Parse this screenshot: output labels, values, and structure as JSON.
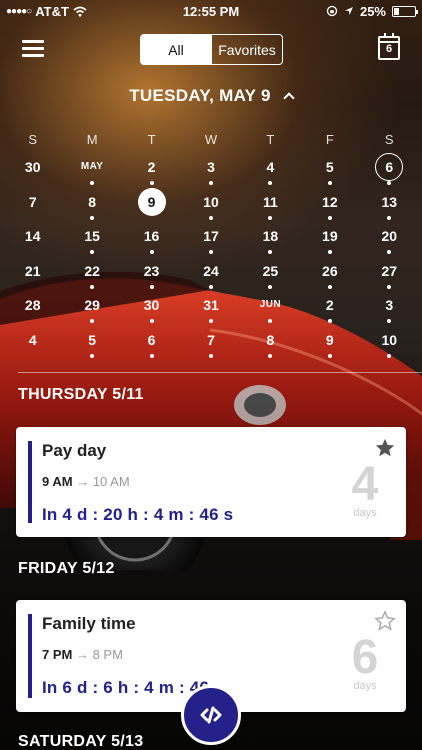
{
  "status_bar": {
    "carrier": "AT&T",
    "time": "12:55 PM",
    "battery": "25%",
    "battery_level": 0.25
  },
  "nav": {
    "tabs": [
      {
        "label": "All",
        "active": true
      },
      {
        "label": "Favorites",
        "active": false
      }
    ],
    "calendar_day": "6"
  },
  "calendar": {
    "header": "TUESDAY, MAY 9",
    "weekdays": [
      "S",
      "M",
      "T",
      "W",
      "T",
      "F",
      "S"
    ],
    "weeks": [
      [
        {
          "d": "30",
          "dot": false
        },
        {
          "d": "MAY",
          "dot": true
        },
        {
          "d": "2",
          "dot": true
        },
        {
          "d": "3",
          "dot": true
        },
        {
          "d": "4",
          "dot": true
        },
        {
          "d": "5",
          "dot": true
        },
        {
          "d": "6",
          "dot": true,
          "state": "selected"
        }
      ],
      [
        {
          "d": "7",
          "dot": false
        },
        {
          "d": "8",
          "dot": true
        },
        {
          "d": "9",
          "dot": false,
          "state": "today"
        },
        {
          "d": "10",
          "dot": true
        },
        {
          "d": "11",
          "dot": true
        },
        {
          "d": "12",
          "dot": true
        },
        {
          "d": "13",
          "dot": true
        }
      ],
      [
        {
          "d": "14",
          "dot": false
        },
        {
          "d": "15",
          "dot": true
        },
        {
          "d": "16",
          "dot": true
        },
        {
          "d": "17",
          "dot": true
        },
        {
          "d": "18",
          "dot": true
        },
        {
          "d": "19",
          "dot": true
        },
        {
          "d": "20",
          "dot": true
        }
      ],
      [
        {
          "d": "21",
          "dot": false
        },
        {
          "d": "22",
          "dot": true
        },
        {
          "d": "23",
          "dot": true
        },
        {
          "d": "24",
          "dot": true
        },
        {
          "d": "25",
          "dot": true
        },
        {
          "d": "26",
          "dot": true
        },
        {
          "d": "27",
          "dot": true
        }
      ],
      [
        {
          "d": "28",
          "dot": false
        },
        {
          "d": "29",
          "dot": true
        },
        {
          "d": "30",
          "dot": true
        },
        {
          "d": "31",
          "dot": true
        },
        {
          "d": "JUN",
          "dot": true
        },
        {
          "d": "2",
          "dot": true
        },
        {
          "d": "3",
          "dot": true
        }
      ],
      [
        {
          "d": "4",
          "dot": false
        },
        {
          "d": "5",
          "dot": true
        },
        {
          "d": "6",
          "dot": true
        },
        {
          "d": "7",
          "dot": true
        },
        {
          "d": "8",
          "dot": true
        },
        {
          "d": "9",
          "dot": true
        },
        {
          "d": "10",
          "dot": true
        }
      ]
    ]
  },
  "sections": [
    {
      "title": "THURSDAY 5/11",
      "event": {
        "title": "Pay day",
        "start": "9 AM",
        "arrow": "→",
        "end": "10 AM",
        "countdown": "In 4 d : 20 h : 4 m : 46 s",
        "days": "4",
        "days_label": "days",
        "favorite": true
      }
    },
    {
      "title": "FRIDAY 5/12",
      "event": {
        "title": "Family time",
        "start": "7 PM",
        "arrow": "→",
        "end": "8 PM",
        "countdown": "In 6 d : 6 h : 4 m : 46",
        "days": "6",
        "days_label": "days",
        "favorite": false
      }
    },
    {
      "title": "SATURDAY 5/13"
    }
  ],
  "icons": {
    "menu": "hamburger-menu-icon",
    "calendar": "calendar-icon",
    "chevron": "chevron-up-icon",
    "fab": "link-code-icon",
    "star_filled": "star-filled-icon",
    "star_outline": "star-outline-icon"
  },
  "colors": {
    "accent": "#24218a",
    "card_bg": "#ffffff",
    "star": "#555555"
  }
}
